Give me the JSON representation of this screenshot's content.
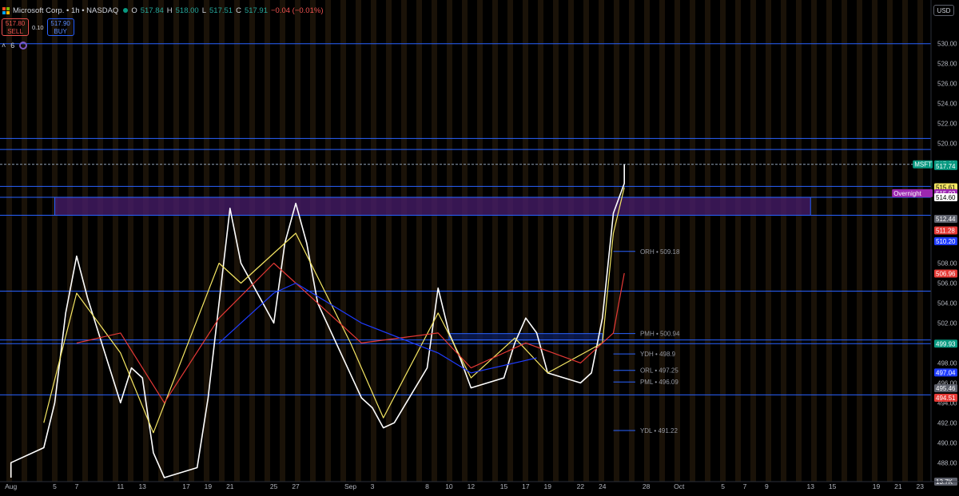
{
  "header": {
    "symbol_title": "Microsoft Corp. • 1h • NASDAQ",
    "open_label": "O",
    "open": "517.84",
    "high_label": "H",
    "high": "518.00",
    "low_label": "L",
    "low": "517.51",
    "close_label": "C",
    "close": "517.91",
    "change": "−0.04 (−0.01%)",
    "currency": "USD"
  },
  "trade": {
    "sell_price": "517.80",
    "sell_label": "SELL",
    "spread": "0.10",
    "buy_price": "517.90",
    "buy_label": "BUY"
  },
  "indicators": {
    "collapse_icon": "chevron-up-icon",
    "count": "6"
  },
  "chart_data": {
    "type": "line",
    "title": "",
    "xlabel": "",
    "ylabel": "",
    "ylim": [
      486.5,
      531.5
    ],
    "grid": false,
    "y_ticks": [
      "530.00",
      "528.00",
      "526.00",
      "524.00",
      "522.00",
      "520.00",
      "508.00",
      "506.00",
      "504.00",
      "502.00",
      "498.00",
      "496.00",
      "494.00",
      "492.00",
      "490.00",
      "488.00"
    ],
    "x_tick_labels": [
      "Aug",
      "5",
      "7",
      "11",
      "13",
      "17",
      "19",
      "21",
      "25",
      "27",
      "Sep",
      "3",
      "8",
      "10",
      "12",
      "15",
      "17",
      "19",
      "22",
      "24",
      "28",
      "Oct",
      "5",
      "7",
      "9",
      "13",
      "15",
      "19",
      "21",
      "23"
    ],
    "x_tick_dates": [
      "2025-08-01",
      "2025-08-05",
      "2025-08-07",
      "2025-08-11",
      "2025-08-13",
      "2025-08-17",
      "2025-08-19",
      "2025-08-21",
      "2025-08-25",
      "2025-08-27",
      "2025-09-01",
      "2025-09-03",
      "2025-09-08",
      "2025-09-10",
      "2025-09-12",
      "2025-09-15",
      "2025-09-17",
      "2025-09-19",
      "2025-09-22",
      "2025-09-24",
      "2025-09-28",
      "2025-10-01",
      "2025-10-05",
      "2025-10-07",
      "2025-10-09",
      "2025-10-13",
      "2025-10-15",
      "2025-10-19",
      "2025-10-21",
      "2025-10-23"
    ],
    "series": [
      {
        "name": "",
        "color": "#ffffff",
        "x": [
          "2025-08-01",
          "2025-08-01",
          "2025-08-04",
          "2025-08-05",
          "2025-08-06",
          "2025-08-07",
          "2025-08-08",
          "2025-08-11",
          "2025-08-12",
          "2025-08-13",
          "2025-08-14",
          "2025-08-15",
          "2025-08-18",
          "2025-08-19",
          "2025-08-20",
          "2025-08-21",
          "2025-08-22",
          "2025-08-25",
          "2025-08-26",
          "2025-08-27",
          "2025-08-28",
          "2025-08-29",
          "2025-09-02",
          "2025-09-03",
          "2025-09-04",
          "2025-09-05",
          "2025-09-08",
          "2025-09-09",
          "2025-09-10",
          "2025-09-11",
          "2025-09-12",
          "2025-09-15",
          "2025-09-16",
          "2025-09-17",
          "2025-09-18",
          "2025-09-19",
          "2025-09-22",
          "2025-09-23",
          "2025-09-24",
          "2025-09-25",
          "2025-09-26",
          "2025-09-26"
        ],
        "y": [
          486.5,
          488.0,
          489.5,
          494.0,
          503.0,
          508.7,
          504.5,
          494.0,
          497.5,
          496.5,
          489.0,
          486.5,
          487.5,
          494.5,
          504.0,
          513.5,
          508.0,
          502.0,
          510.0,
          514.0,
          510.0,
          504.0,
          494.5,
          493.5,
          491.5,
          492.0,
          497.5,
          505.5,
          501.0,
          498.5,
          495.5,
          496.5,
          500.0,
          502.5,
          501.0,
          497.0,
          496.0,
          497.0,
          502.5,
          513.0,
          516.0,
          517.9
        ]
      },
      {
        "name": "",
        "color": "#f5e663",
        "x": [
          "2025-08-04",
          "2025-08-07",
          "2025-08-11",
          "2025-08-14",
          "2025-08-20",
          "2025-08-22",
          "2025-08-27",
          "2025-09-01",
          "2025-09-04",
          "2025-09-09",
          "2025-09-12",
          "2025-09-16",
          "2025-09-19",
          "2025-09-24",
          "2025-09-25",
          "2025-09-26"
        ],
        "y": [
          492.0,
          505.0,
          499.0,
          491.0,
          508.0,
          506.0,
          511.0,
          500.0,
          492.5,
          503.0,
          496.5,
          500.5,
          497.0,
          500.0,
          511.0,
          515.6
        ]
      },
      {
        "name": "",
        "color": "#e53935",
        "x": [
          "2025-08-07",
          "2025-08-11",
          "2025-08-15",
          "2025-08-20",
          "2025-08-25",
          "2025-08-27",
          "2025-09-02",
          "2025-09-09",
          "2025-09-12",
          "2025-09-17",
          "2025-09-22",
          "2025-09-25",
          "2025-09-26"
        ],
        "y": [
          500.0,
          501.0,
          494.0,
          502.5,
          508.0,
          506.0,
          500.0,
          501.0,
          497.5,
          500.0,
          498.0,
          501.0,
          507.0
        ]
      },
      {
        "name": "",
        "color": "#1e3cff",
        "x": [
          "2025-08-20",
          "2025-08-25",
          "2025-08-27",
          "2025-09-02",
          "2025-09-09",
          "2025-09-12",
          "2025-09-18"
        ],
        "y": [
          500.0,
          505.0,
          506.0,
          502.0,
          499.0,
          497.0,
          498.5
        ]
      }
    ],
    "levels": [
      {
        "value": 530.0,
        "color": "#2962ff",
        "label": ""
      },
      {
        "value": 520.5,
        "color": "#2962ff",
        "label": ""
      },
      {
        "value": 519.4,
        "color": "#2962ff",
        "label": ""
      },
      {
        "value": 515.7,
        "color": "#2962ff",
        "label": ""
      },
      {
        "value": 514.6,
        "color": "#2962ff",
        "label": ""
      },
      {
        "value": 512.8,
        "color": "#2962ff",
        "label": ""
      },
      {
        "value": 505.2,
        "color": "#2962ff",
        "label": ""
      },
      {
        "value": 500.94,
        "color": "#2962ff",
        "label": "PMH • 500.94"
      },
      {
        "value": 500.3,
        "color": "#2962ff",
        "label": ""
      },
      {
        "value": 499.93,
        "color": "#2962ff",
        "label": ""
      },
      {
        "value": 498.9,
        "color": "#2962ff",
        "label": "YDH • 498.9"
      },
      {
        "value": 497.25,
        "color": "#2962ff",
        "label": "ORL • 497.25"
      },
      {
        "value": 496.09,
        "color": "#2962ff",
        "label": "PML • 496.09"
      },
      {
        "value": 494.8,
        "color": "#2962ff",
        "label": ""
      },
      {
        "value": 491.22,
        "color": "#2962ff",
        "label": "YDL • 491.22"
      },
      {
        "value": 509.18,
        "color": "#2962ff",
        "label": "ORH • 509.18"
      }
    ],
    "price_tags": [
      {
        "text": "517.91",
        "value": 517.91,
        "bg": "#089981",
        "fg": "#ffffff",
        "name_tag": "MSFT"
      },
      {
        "text": "517.74",
        "value": 517.74,
        "bg": "#089981",
        "fg": "#ffffff"
      },
      {
        "text": "515.61",
        "value": 515.61,
        "bg": "#f5e663",
        "fg": "#000000"
      },
      {
        "text": "515.02",
        "value": 515.02,
        "bg": "#9c27b0",
        "fg": "#ffffff",
        "name_tag": "Overnight"
      },
      {
        "text": "514.60",
        "value": 514.6,
        "bg": "#ffffff",
        "fg": "#000000"
      },
      {
        "text": "512.44",
        "value": 512.44,
        "bg": "#5d606b",
        "fg": "#ffffff"
      },
      {
        "text": "511.28",
        "value": 511.28,
        "bg": "#e53935",
        "fg": "#ffffff"
      },
      {
        "text": "510.20",
        "value": 510.2,
        "bg": "#1e3cff",
        "fg": "#ffffff"
      },
      {
        "text": "506.96",
        "value": 506.96,
        "bg": "#e53935",
        "fg": "#ffffff"
      },
      {
        "text": "499.93",
        "value": 499.93,
        "bg": "#089981",
        "fg": "#ffffff"
      },
      {
        "text": "497.04",
        "value": 497.04,
        "bg": "#1e3cff",
        "fg": "#ffffff"
      },
      {
        "text": "495.46",
        "value": 495.46,
        "bg": "#5d606b",
        "fg": "#ffffff"
      },
      {
        "text": "494.51",
        "value": 494.51,
        "bg": "#e53935",
        "fg": "#ffffff"
      },
      {
        "text": "13.7K",
        "value": 486.1,
        "bg": "#5d606b",
        "fg": "#ffffff"
      }
    ],
    "zones": [
      {
        "x0": "2025-08-05",
        "x1": "2025-10-13",
        "y0": 512.8,
        "y1": 514.6,
        "fill": "#4a1e6e"
      },
      {
        "x0": "2025-09-10",
        "x1": "2025-09-24",
        "y0": 500.3,
        "y1": 500.94,
        "fill": "#0c1e5e"
      }
    ],
    "last_price": 517.91
  }
}
